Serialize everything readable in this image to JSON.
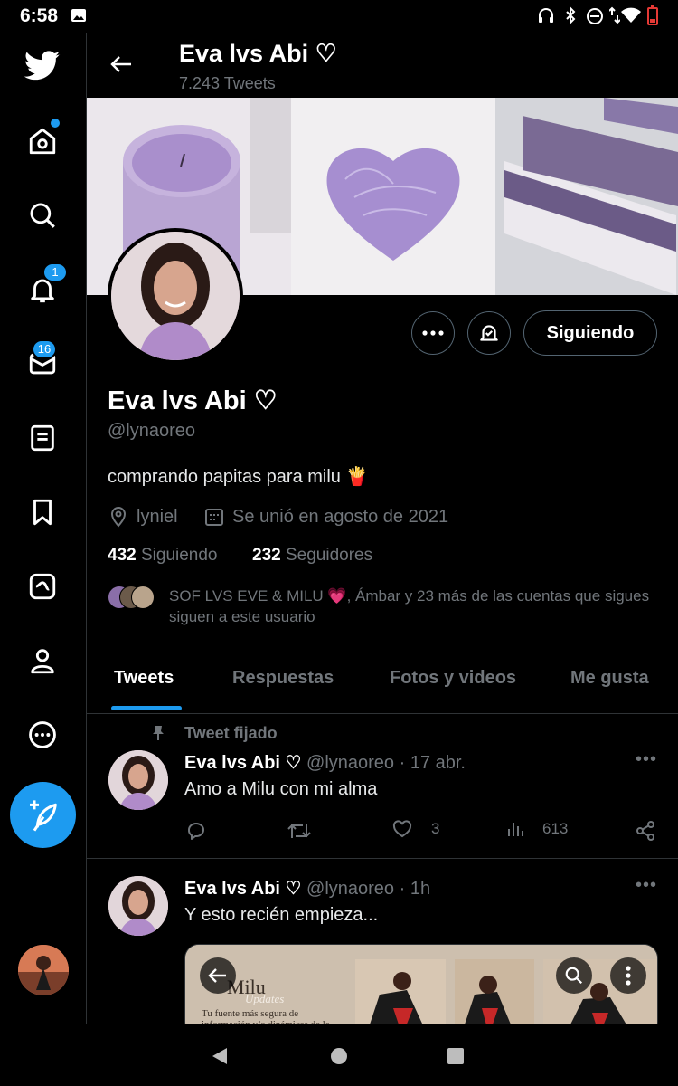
{
  "status_bar": {
    "time": "6:58"
  },
  "sidebar": {
    "notifications_badge": "1",
    "messages_badge": "16"
  },
  "header": {
    "name": "Eva lvs Abi ♡",
    "tweet_count": "7.243 Tweets"
  },
  "profile": {
    "name": "Eva lvs Abi ♡",
    "handle": "@lynaoreo",
    "bio": "comprando papitas para milu 🍟",
    "location": "lyniel",
    "joined": "Se unió en agosto de 2021",
    "following_count": "432",
    "following_label": "Siguiendo",
    "followers_count": "232",
    "followers_label": "Seguidores",
    "follow_button": "Siguiendo",
    "mutual_followers": "SOF LVS EVE & MILU 💗, Ámbar y 23 más de las cuentas que sigues siguen a este usuario"
  },
  "tabs": [
    "Tweets",
    "Respuestas",
    "Fotos y videos",
    "Me gusta"
  ],
  "tweets": [
    {
      "pinned_label": "Tweet fijado",
      "name": "Eva lvs Abi ♡",
      "meta": "@lynaoreo · 17 abr.",
      "text": "Amo a Milu con mi alma",
      "likes": "3",
      "views": "613"
    },
    {
      "name": "Eva lvs Abi ♡",
      "meta": "@lynaoreo · 1h",
      "text": "Y esto recién empieza...",
      "media_title": "Milu",
      "media_subtitle": "Updates",
      "media_caption": "Tu fuente más segura de información y/o dinámicas de la"
    }
  ],
  "colors": {
    "accent": "#1d9bf0",
    "background": "#000000",
    "muted": "#71767b",
    "border": "#2f3336"
  }
}
